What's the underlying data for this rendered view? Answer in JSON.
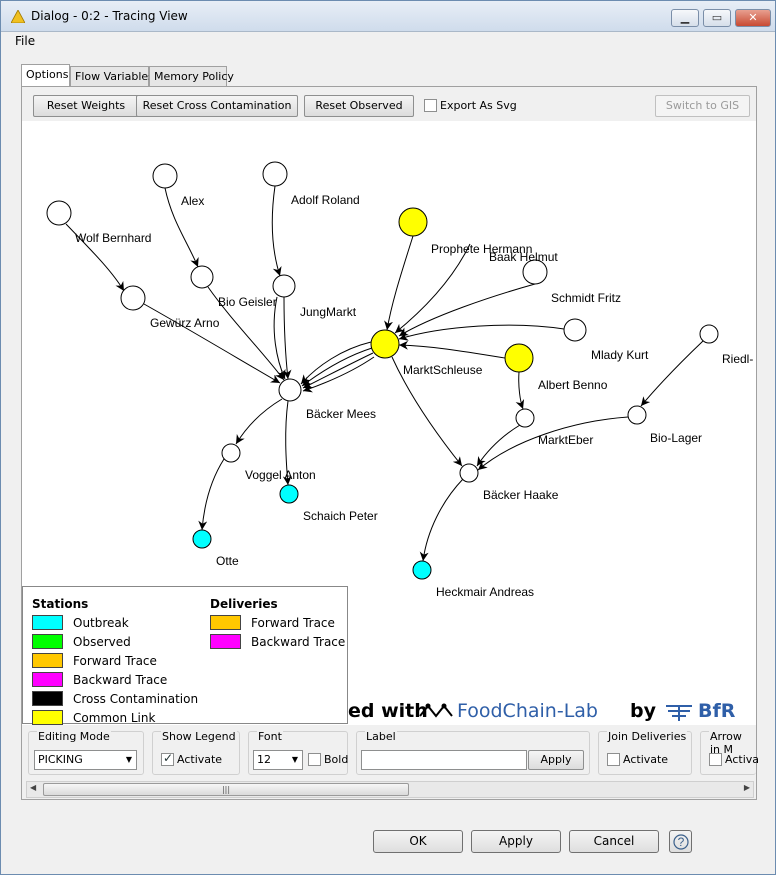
{
  "window": {
    "title": "Dialog - 0:2 - Tracing View"
  },
  "menu": {
    "file": "File"
  },
  "tabs": [
    "Options",
    "Flow Variables",
    "Memory Policy"
  ],
  "toolbar": {
    "reset_weights": "Reset Weights",
    "reset_cross": "Reset Cross Contamination",
    "reset_observed": "Reset Observed",
    "export_svg": "Export As Svg",
    "switch_gis": "Switch to GIS"
  },
  "graph": {
    "nodes": [
      {
        "id": "alex",
        "label": "Alex",
        "color": "#ffffff"
      },
      {
        "id": "adolf",
        "label": "Adolf Roland",
        "color": "#ffffff"
      },
      {
        "id": "wolf",
        "label": "Wolf Bernhard",
        "color": "#ffffff"
      },
      {
        "id": "bio_geisler",
        "label": "Bio Geisler",
        "color": "#ffffff"
      },
      {
        "id": "jungmarkt",
        "label": "JungMarkt",
        "color": "#ffffff"
      },
      {
        "id": "gewuerz",
        "label": "Gewürz Arno",
        "color": "#ffffff"
      },
      {
        "id": "prophete",
        "label": "Prophete Hermann",
        "color": "#ffff00"
      },
      {
        "id": "baak",
        "label": "Baak Helmut",
        "color": "#ffffff"
      },
      {
        "id": "yellow1",
        "label": "",
        "color": "#ffff00"
      },
      {
        "id": "schmidt",
        "label": "Schmidt Fritz",
        "color": "#ffffff"
      },
      {
        "id": "marktschleuse",
        "label": "MarktSchleuse",
        "color": "#ffff00"
      },
      {
        "id": "mlady",
        "label": "Mlady  Kurt",
        "color": "#ffffff"
      },
      {
        "id": "riedl",
        "label": "Riedl-",
        "color": "#ffffff"
      },
      {
        "id": "albert",
        "label": "Albert Benno",
        "color": "#ffff00"
      },
      {
        "id": "baecker_mees",
        "label": "Bäcker Mees",
        "color": "#ffffff"
      },
      {
        "id": "markteber",
        "label": "MarktEber",
        "color": "#ffffff"
      },
      {
        "id": "biolager",
        "label": "Bio-Lager",
        "color": "#ffffff"
      },
      {
        "id": "voggel",
        "label": "Voggel Anton",
        "color": "#ffffff"
      },
      {
        "id": "schaich",
        "label": "Schaich Peter",
        "color": "#00ffff"
      },
      {
        "id": "baecker_haake",
        "label": "Bäcker Haake",
        "color": "#ffffff"
      },
      {
        "id": "otte",
        "label": "Otte",
        "color": "#00ffff"
      },
      {
        "id": "heckmair",
        "label": "Heckmair Andreas",
        "color": "#00ffff"
      }
    ]
  },
  "legend": {
    "stations_title": "Stations",
    "deliveries_title": "Deliveries",
    "stations": [
      {
        "label": "Outbreak",
        "color": "#00ffff"
      },
      {
        "label": "Observed",
        "color": "#00ff00"
      },
      {
        "label": "Forward Trace",
        "color": "#ffc800"
      },
      {
        "label": "Backward Trace",
        "color": "#ff00ff"
      },
      {
        "label": "Cross Contamination",
        "color": "#000000"
      },
      {
        "label": "Common Link",
        "color": "#ffff00"
      }
    ],
    "deliveries": [
      {
        "label": "Forward Trace",
        "color": "#ffc800"
      },
      {
        "label": "Backward Trace",
        "color": "#ff00ff"
      }
    ]
  },
  "banner": {
    "prefix": "ed with",
    "brand": "FoodChain-Lab",
    "by": "by",
    "org": "BfR"
  },
  "controls": {
    "editing_mode_label": "Editing Mode",
    "editing_mode_value": "PICKING",
    "show_legend_label": "Show Legend",
    "activate": "Activate",
    "font_label": "Font",
    "font_size": "12",
    "bold": "Bold",
    "label_label": "Label",
    "label_value": "",
    "apply": "Apply",
    "join_deliveries_label": "Join Deliveries",
    "arrow_label": "Arrow in M",
    "arrow_activate": "Activa"
  },
  "footer": {
    "ok": "OK",
    "apply": "Apply",
    "cancel": "Cancel",
    "help": "?"
  },
  "icons": {
    "warning": "warning-triangle-icon",
    "help": "help-icon"
  }
}
